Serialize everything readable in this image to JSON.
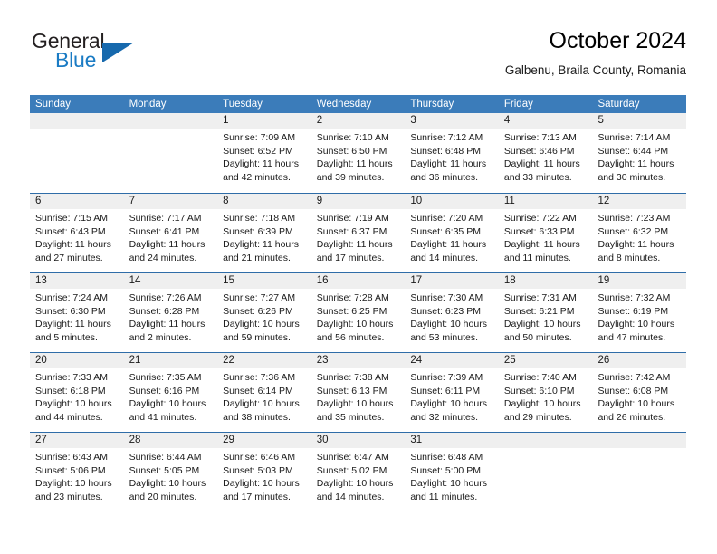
{
  "brand": {
    "name_primary": "General",
    "name_secondary": "Blue",
    "logo_icon": "triangle-logo-icon"
  },
  "header": {
    "title": "October 2024",
    "subtitle": "Galbenu, Braila County, Romania"
  },
  "colors": {
    "header_blue": "#3b7cba",
    "row_divider_blue": "#2f6da8",
    "date_band_gray": "#efefef",
    "brand_blue": "#1a7bc4",
    "text": "#1a1a1a"
  },
  "calendar": {
    "weekdays": [
      "Sunday",
      "Monday",
      "Tuesday",
      "Wednesday",
      "Thursday",
      "Friday",
      "Saturday"
    ],
    "weeks": [
      [
        {
          "day": "",
          "info": ""
        },
        {
          "day": "",
          "info": ""
        },
        {
          "day": "1",
          "info": "Sunrise: 7:09 AM\nSunset: 6:52 PM\nDaylight: 11 hours\nand 42 minutes."
        },
        {
          "day": "2",
          "info": "Sunrise: 7:10 AM\nSunset: 6:50 PM\nDaylight: 11 hours\nand 39 minutes."
        },
        {
          "day": "3",
          "info": "Sunrise: 7:12 AM\nSunset: 6:48 PM\nDaylight: 11 hours\nand 36 minutes."
        },
        {
          "day": "4",
          "info": "Sunrise: 7:13 AM\nSunset: 6:46 PM\nDaylight: 11 hours\nand 33 minutes."
        },
        {
          "day": "5",
          "info": "Sunrise: 7:14 AM\nSunset: 6:44 PM\nDaylight: 11 hours\nand 30 minutes."
        }
      ],
      [
        {
          "day": "6",
          "info": "Sunrise: 7:15 AM\nSunset: 6:43 PM\nDaylight: 11 hours\nand 27 minutes."
        },
        {
          "day": "7",
          "info": "Sunrise: 7:17 AM\nSunset: 6:41 PM\nDaylight: 11 hours\nand 24 minutes."
        },
        {
          "day": "8",
          "info": "Sunrise: 7:18 AM\nSunset: 6:39 PM\nDaylight: 11 hours\nand 21 minutes."
        },
        {
          "day": "9",
          "info": "Sunrise: 7:19 AM\nSunset: 6:37 PM\nDaylight: 11 hours\nand 17 minutes."
        },
        {
          "day": "10",
          "info": "Sunrise: 7:20 AM\nSunset: 6:35 PM\nDaylight: 11 hours\nand 14 minutes."
        },
        {
          "day": "11",
          "info": "Sunrise: 7:22 AM\nSunset: 6:33 PM\nDaylight: 11 hours\nand 11 minutes."
        },
        {
          "day": "12",
          "info": "Sunrise: 7:23 AM\nSunset: 6:32 PM\nDaylight: 11 hours\nand 8 minutes."
        }
      ],
      [
        {
          "day": "13",
          "info": "Sunrise: 7:24 AM\nSunset: 6:30 PM\nDaylight: 11 hours\nand 5 minutes."
        },
        {
          "day": "14",
          "info": "Sunrise: 7:26 AM\nSunset: 6:28 PM\nDaylight: 11 hours\nand 2 minutes."
        },
        {
          "day": "15",
          "info": "Sunrise: 7:27 AM\nSunset: 6:26 PM\nDaylight: 10 hours\nand 59 minutes."
        },
        {
          "day": "16",
          "info": "Sunrise: 7:28 AM\nSunset: 6:25 PM\nDaylight: 10 hours\nand 56 minutes."
        },
        {
          "day": "17",
          "info": "Sunrise: 7:30 AM\nSunset: 6:23 PM\nDaylight: 10 hours\nand 53 minutes."
        },
        {
          "day": "18",
          "info": "Sunrise: 7:31 AM\nSunset: 6:21 PM\nDaylight: 10 hours\nand 50 minutes."
        },
        {
          "day": "19",
          "info": "Sunrise: 7:32 AM\nSunset: 6:19 PM\nDaylight: 10 hours\nand 47 minutes."
        }
      ],
      [
        {
          "day": "20",
          "info": "Sunrise: 7:33 AM\nSunset: 6:18 PM\nDaylight: 10 hours\nand 44 minutes."
        },
        {
          "day": "21",
          "info": "Sunrise: 7:35 AM\nSunset: 6:16 PM\nDaylight: 10 hours\nand 41 minutes."
        },
        {
          "day": "22",
          "info": "Sunrise: 7:36 AM\nSunset: 6:14 PM\nDaylight: 10 hours\nand 38 minutes."
        },
        {
          "day": "23",
          "info": "Sunrise: 7:38 AM\nSunset: 6:13 PM\nDaylight: 10 hours\nand 35 minutes."
        },
        {
          "day": "24",
          "info": "Sunrise: 7:39 AM\nSunset: 6:11 PM\nDaylight: 10 hours\nand 32 minutes."
        },
        {
          "day": "25",
          "info": "Sunrise: 7:40 AM\nSunset: 6:10 PM\nDaylight: 10 hours\nand 29 minutes."
        },
        {
          "day": "26",
          "info": "Sunrise: 7:42 AM\nSunset: 6:08 PM\nDaylight: 10 hours\nand 26 minutes."
        }
      ],
      [
        {
          "day": "27",
          "info": "Sunrise: 6:43 AM\nSunset: 5:06 PM\nDaylight: 10 hours\nand 23 minutes."
        },
        {
          "day": "28",
          "info": "Sunrise: 6:44 AM\nSunset: 5:05 PM\nDaylight: 10 hours\nand 20 minutes."
        },
        {
          "day": "29",
          "info": "Sunrise: 6:46 AM\nSunset: 5:03 PM\nDaylight: 10 hours\nand 17 minutes."
        },
        {
          "day": "30",
          "info": "Sunrise: 6:47 AM\nSunset: 5:02 PM\nDaylight: 10 hours\nand 14 minutes."
        },
        {
          "day": "31",
          "info": "Sunrise: 6:48 AM\nSunset: 5:00 PM\nDaylight: 10 hours\nand 11 minutes."
        },
        {
          "day": "",
          "info": ""
        },
        {
          "day": "",
          "info": ""
        }
      ]
    ]
  }
}
